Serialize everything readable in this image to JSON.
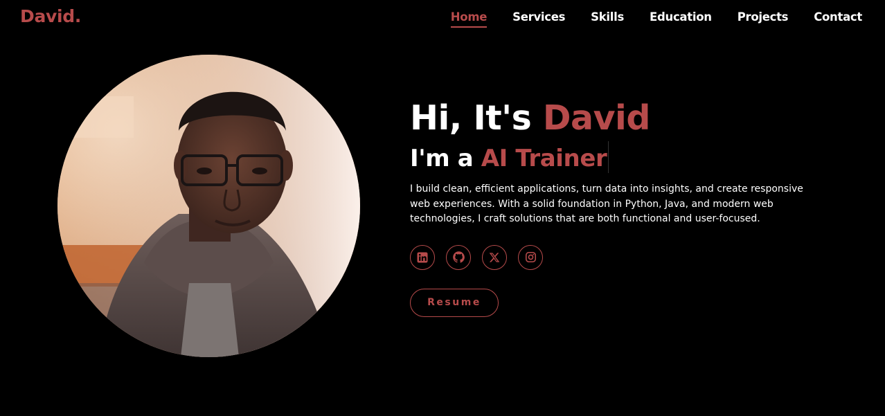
{
  "brand": {
    "logo": "David."
  },
  "nav": {
    "items": [
      {
        "label": "Home",
        "active": true
      },
      {
        "label": "Services",
        "active": false
      },
      {
        "label": "Skills",
        "active": false
      },
      {
        "label": "Education",
        "active": false
      },
      {
        "label": "Projects",
        "active": false
      },
      {
        "label": "Contact",
        "active": false
      }
    ]
  },
  "hero": {
    "greeting_prefix": "Hi, It's",
    "greeting_name": "David",
    "role_prefix": "I'm a",
    "role_title": "AI Trainer",
    "intro": "I build clean, efficient applications, turn data into insights, and create responsive web experiences. With a solid foundation in Python, Java, and modern web technologies, I craft solutions that are both functional and user-focused.",
    "socials": [
      {
        "icon": "linkedin-icon"
      },
      {
        "icon": "github-icon"
      },
      {
        "icon": "x-twitter-icon"
      },
      {
        "icon": "instagram-icon"
      }
    ],
    "resume_label": "Resume"
  },
  "colors": {
    "accent": "#b74b4b",
    "background": "#000000",
    "text": "#ffffff"
  }
}
